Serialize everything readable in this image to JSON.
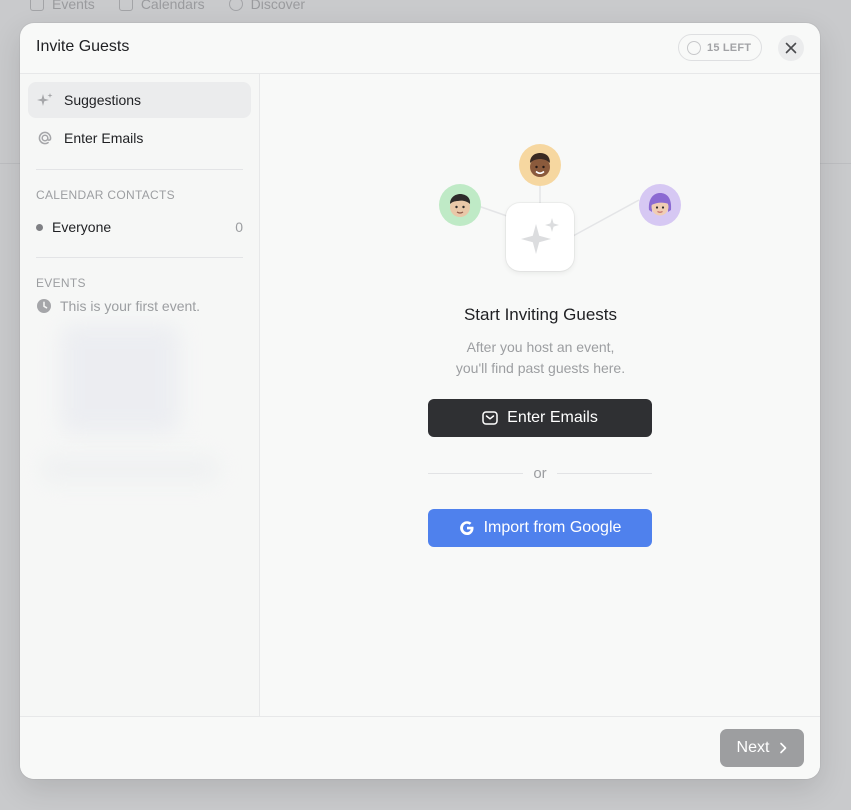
{
  "background_nav": {
    "items": [
      "Events",
      "Calendars",
      "Discover"
    ]
  },
  "modal": {
    "title": "Invite Guests",
    "remaining_badge": "15 LEFT"
  },
  "sidebar": {
    "nav": [
      {
        "label": "Suggestions",
        "icon": "sparkle-icon",
        "active": true
      },
      {
        "label": "Enter Emails",
        "icon": "at-icon",
        "active": false
      }
    ],
    "contacts_heading": "CALENDAR CONTACTS",
    "contacts": [
      {
        "label": "Everyone",
        "count": "0"
      }
    ],
    "events_heading": "EVENTS",
    "events_empty": "This is your first event."
  },
  "main": {
    "title": "Start Inviting Guests",
    "subtitle_line1": "After you host an event,",
    "subtitle_line2": "you'll find past guests here.",
    "enter_emails_label": "Enter Emails",
    "or_label": "or",
    "google_label": "Import from Google",
    "avatars": [
      {
        "icon": "memoji-avatar-green",
        "bg": "#bfeac6"
      },
      {
        "icon": "memoji-avatar-orange",
        "bg": "#f6d7a0"
      },
      {
        "icon": "memoji-avatar-purple",
        "bg": "#d6c8f3"
      }
    ]
  },
  "footer": {
    "next_label": "Next"
  },
  "colors": {
    "primary_dark": "#2f3033",
    "google_blue": "#4f81ed",
    "next_disabled": "#9d9ea0"
  }
}
